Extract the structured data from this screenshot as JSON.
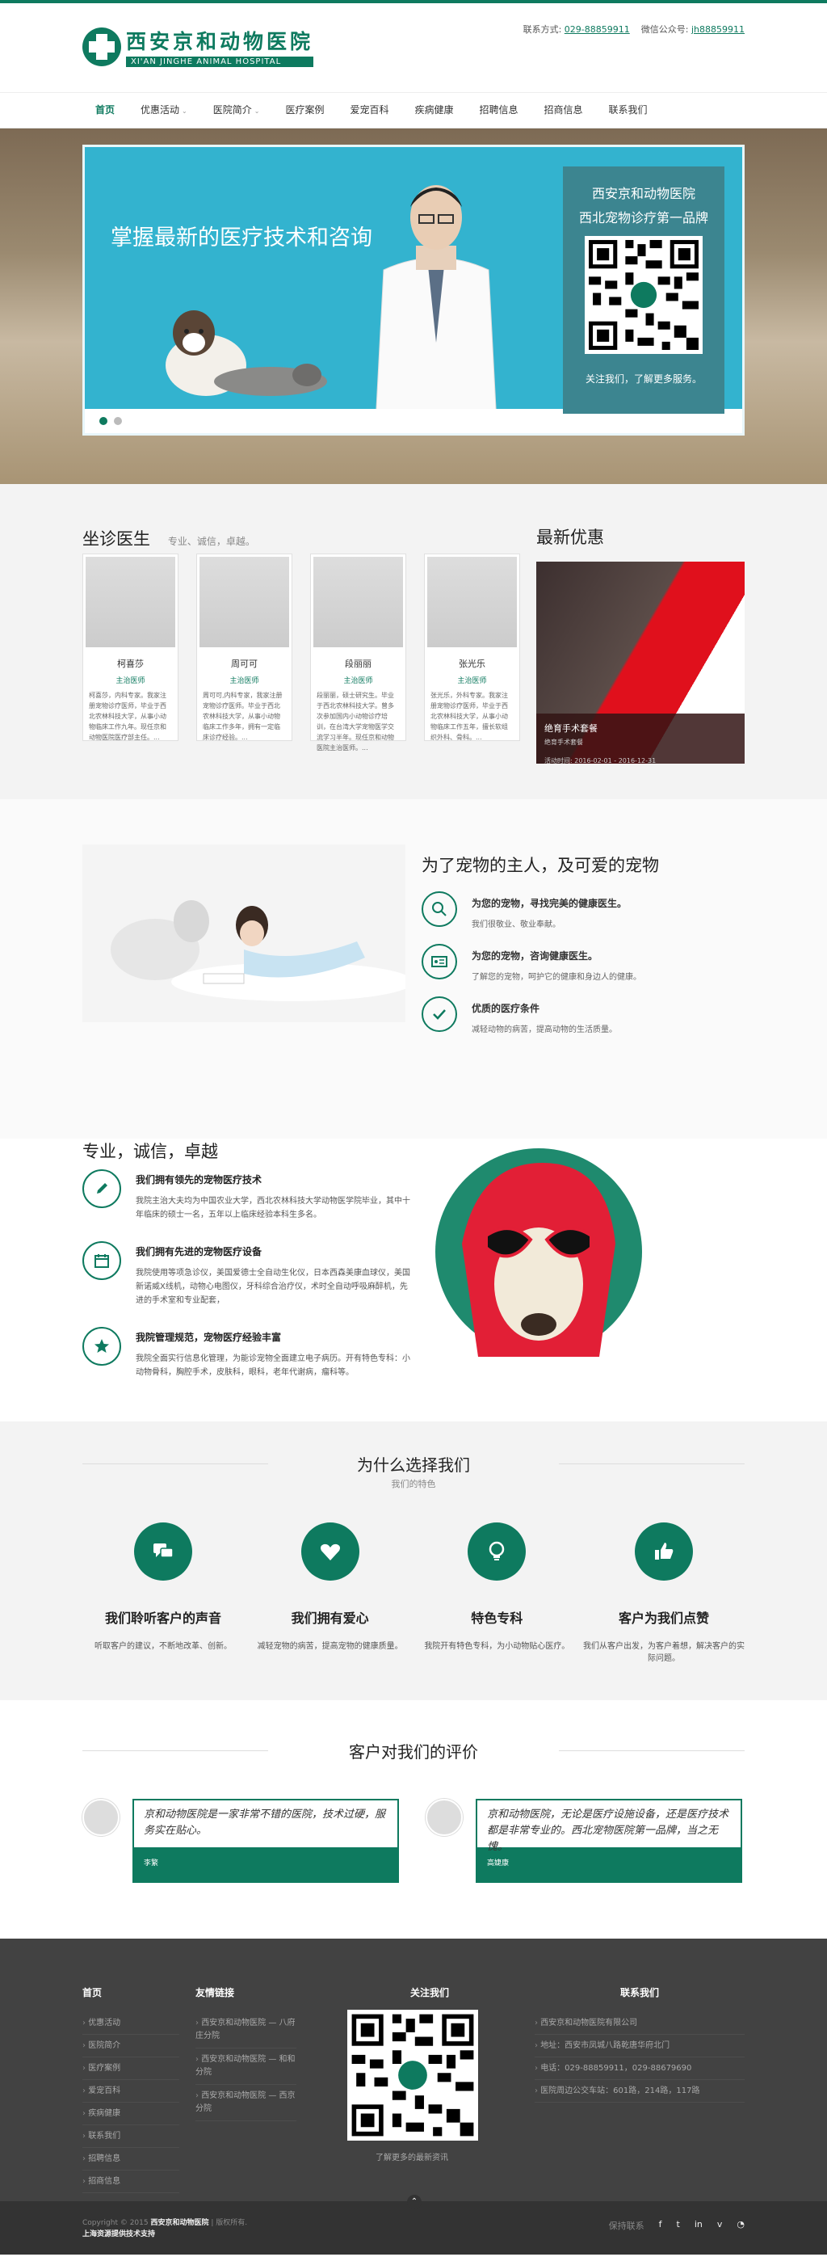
{
  "header": {
    "logo_cn": "西安京和动物医院",
    "logo_en": "XI'AN JINGHE ANIMAL HOSPITAL",
    "phone_label": "联系方式:",
    "phone": "029-88859911",
    "wechat_label": "微信公众号:",
    "wechat": "jh88859911"
  },
  "nav": {
    "items": [
      {
        "label": "首页"
      },
      {
        "label": "优惠活动",
        "caret": "⌄"
      },
      {
        "label": "医院简介",
        "caret": "⌄"
      },
      {
        "label": "医疗案例"
      },
      {
        "label": "爱宠百科"
      },
      {
        "label": "疾病健康"
      },
      {
        "label": "招聘信息"
      },
      {
        "label": "招商信息"
      },
      {
        "label": "联系我们"
      }
    ]
  },
  "hero": {
    "headline": "掌握最新的医疗技术和咨询",
    "qr_title1": "西安京和动物医院",
    "qr_title2": "西北宠物诊疗第一品牌",
    "qr_caption": "关注我们，了解更多服务。"
  },
  "doctors": {
    "title": "坐诊医生",
    "subtitle": "专业、诚信，卓越。",
    "list": [
      {
        "name": "柯喜莎",
        "title": "主治医师",
        "desc": "柯喜莎，内科专家。我家注册宠物诊疗医师，毕业于西北农林科技大学，从事小动物临床工作九年。现任京和动物医院医疗部主任。..."
      },
      {
        "name": "周可可",
        "title": "主治医师",
        "desc": "周可可,内科专家，我家注册宠物诊疗医师。毕业于西北农林科技大学，从事小动物临床工作多年，拥有一定临床诊疗经验。..."
      },
      {
        "name": "段丽丽",
        "title": "主治医师",
        "desc": "段丽丽，硕士研究生。毕业于西北农林科技大学。曾多次参加国内小动物诊疗培训，在台湾大学宠物医学交流学习半年。现任京和动物医院主治医师。..."
      },
      {
        "name": "张光乐",
        "title": "主治医师",
        "desc": "张光乐，外科专家。我家注册宠物诊疗医师，毕业于西北农林科技大学，从事小动物临床工作五年，擅长软组织外科、骨科。..."
      }
    ]
  },
  "promo": {
    "title": "最新优惠",
    "caption_title": "绝育手术套餐",
    "caption_sub": "绝育手术套餐",
    "caption_date": "活动时间: 2016-02-01 - 2016-12-31"
  },
  "pets": {
    "title": "为了宠物的主人，及可爱的宠物",
    "features": [
      {
        "title": "为您的宠物，寻找完美的健康医生。",
        "desc": "我们很敬业、敬业奉献。"
      },
      {
        "title": "为您的宠物，咨询健康医生。",
        "desc": "了解您的宠物，呵护它的健康和身边人的健康。"
      },
      {
        "title": "优质的医疗条件",
        "desc": "减轻动物的病苦，提高动物的生活质量。"
      }
    ]
  },
  "pro": {
    "title": "专业，诚信，卓越",
    "items": [
      {
        "title": "我们拥有领先的宠物医疗技术",
        "desc": "我院主治大夫均为中国农业大学，西北农林科技大学动物医学院毕业，其中十年临床的硕士一名，五年以上临床经验本科生多名。"
      },
      {
        "title": "我们拥有先进的宠物医疗设备",
        "desc": "我院使用等项急诊仪，美国爱德士全自动生化仪，日本西森美康血球仪，美国新诺威X线机，动物心电图仪，牙科综合治疗仪，术时全自动呼吸麻醉机，先进的手术室和专业配套，"
      },
      {
        "title": "我院管理规范，宠物医疗经验丰富",
        "desc": "我院全面实行信息化管理，为能诊宠物全面建立电子病历。开有特色专科：小动物骨科，胸腔手术，皮肤科，眼科，老年代谢病，瘤科等。"
      }
    ]
  },
  "why": {
    "title": "为什么选择我们",
    "subtitle": "我们的特色",
    "items": [
      {
        "title": "我们聆听客户的声音",
        "desc": "听取客户的建议，不断地改革、创新。"
      },
      {
        "title": "我们拥有爱心",
        "desc": "减轻宠物的病苦，提高宠物的健康质量。"
      },
      {
        "title": "特色专科",
        "desc": "我院开有特色专科，为小动物贴心医疗。"
      },
      {
        "title": "客户为我们点赞",
        "desc": "我们从客户出发，为客户着想，解决客户的实际问题。"
      }
    ]
  },
  "reviews": {
    "title": "客户对我们的评价",
    "items": [
      {
        "quote": "京和动物医院是一家非常不错的医院，技术过硬，服务实在贴心。",
        "name": "李繁"
      },
      {
        "quote": "京和动物医院，无论是医疗设施设备，还是医疗技术都是非常专业的。西北宠物医院第一品牌，当之无愧。",
        "name": "高婕康"
      }
    ]
  },
  "footer": {
    "col1_title": "首页",
    "col1_items": [
      "优惠活动",
      "医院简介",
      "医疗案例",
      "爱宠百科",
      "疾病健康",
      "联系我们",
      "招聘信息",
      "招商信息"
    ],
    "col2_title": "友情链接",
    "col2_items": [
      "西安京和动物医院 — 八府庄分院",
      "西安京和动物医院 — 和和分院",
      "西安京和动物医院 — 西京分院"
    ],
    "col3_title": "关注我们",
    "qr_caption": "了解更多的最新资讯",
    "col4_title": "联系我们",
    "col4_items": [
      "西安京和动物医院有限公司",
      "地址：西安市凤城八路乾唐华府北门",
      "电话：029-88859911，029-88679690",
      "医院周边公交车站：601路，214路，117路"
    ],
    "copyright": "Copyright © 2015",
    "company": "西安京和动物医院",
    "rights": "| 版权所有.",
    "support": "上海资源提供技术支持",
    "social_label": "保持联系"
  }
}
